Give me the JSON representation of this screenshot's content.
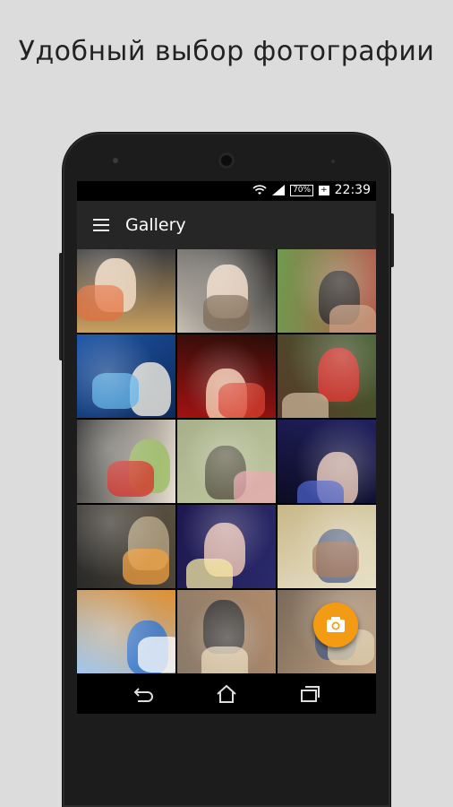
{
  "promo": {
    "headline": "Удобный выбор фотографии"
  },
  "status_bar": {
    "battery": "70%",
    "time": "22:39",
    "icons": [
      "wifi-icon",
      "signal-icon",
      "battery-icon"
    ]
  },
  "app_bar": {
    "title": "Gallery",
    "menu_icon": "hamburger-menu-icon"
  },
  "gallery": {
    "photos": [
      {
        "name": "photo-girl-graffiti",
        "colors": [
          "#c9a060",
          "#e36d3c",
          "#f2d9c0",
          "#3b3b3b"
        ]
      },
      {
        "name": "photo-girl-street",
        "colors": [
          "#c7c0b4",
          "#7d6b55",
          "#f0d9c4",
          "#2a2a2a"
        ]
      },
      {
        "name": "photo-man-sunglasses",
        "colors": [
          "#6f9a4f",
          "#caa083",
          "#2c2c2c",
          "#b25a4a"
        ]
      },
      {
        "name": "photo-party-dance",
        "colors": [
          "#1e56a8",
          "#5ab0e8",
          "#e8e4da",
          "#0c2a5a"
        ]
      },
      {
        "name": "photo-girl-red-bg",
        "colors": [
          "#a11212",
          "#d84030",
          "#f1c4a8",
          "#2a0d08"
        ]
      },
      {
        "name": "photo-yoda-hat-rotated",
        "colors": [
          "#5a3a2a",
          "#c9b49a",
          "#d8302a",
          "#3e5a2a"
        ]
      },
      {
        "name": "photo-yoda-rotated",
        "colors": [
          "#3a3a3a",
          "#d8302a",
          "#9fbf6a",
          "#e8e0d0"
        ]
      },
      {
        "name": "photo-mask-closeup",
        "colors": [
          "#a8b08a",
          "#e8a8b0",
          "#5e5a4a",
          "#c0c8a0"
        ]
      },
      {
        "name": "photo-girl-stage",
        "colors": [
          "#0c0c22",
          "#4a60c8",
          "#e0c0b0",
          "#202060"
        ]
      },
      {
        "name": "photo-selfie-hat",
        "colors": [
          "#2a2a2a",
          "#f0a040",
          "#b0a080",
          "#5a5040"
        ]
      },
      {
        "name": "photo-two-girls",
        "colors": [
          "#1e1850",
          "#f4e8a0",
          "#e8c0b0",
          "#2a2a6a"
        ]
      },
      {
        "name": "photo-teddy-rotated",
        "colors": [
          "#c8b888",
          "#a87858",
          "#5a6a8a",
          "#e8e0c8"
        ]
      },
      {
        "name": "photo-cocktail",
        "colors": [
          "#a0c8f0",
          "#ffffff",
          "#3a7ad0",
          "#e09030"
        ]
      },
      {
        "name": "photo-teddy-girl",
        "colors": [
          "#8a7a6a",
          "#e8d8b8",
          "#3a3a3a",
          "#b08a6a"
        ]
      },
      {
        "name": "photo-teddy-girl-2",
        "colors": [
          "#7a6a5a",
          "#e0d0b0",
          "#4a5a7a",
          "#c0a080"
        ]
      }
    ]
  },
  "fab": {
    "icon": "camera-icon",
    "color": "#f39b13"
  },
  "nav_bar": {
    "buttons": [
      "back-icon",
      "home-icon",
      "recent-apps-icon"
    ]
  }
}
